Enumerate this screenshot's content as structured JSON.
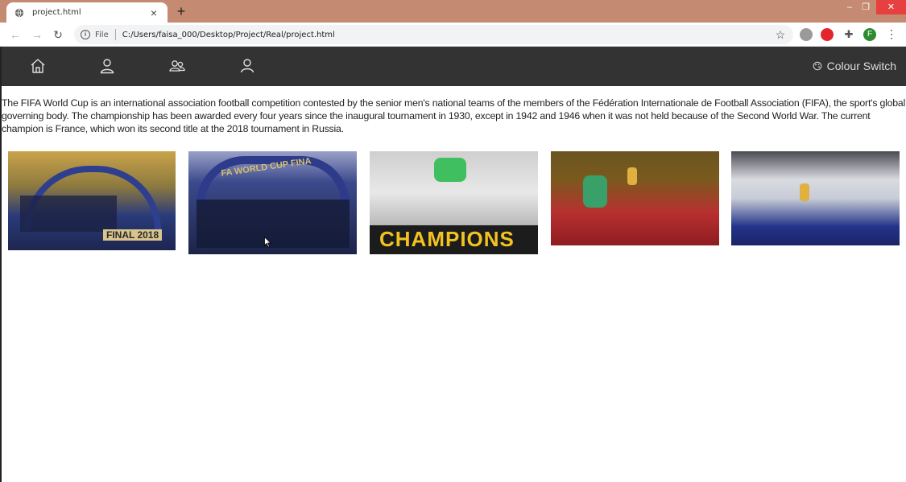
{
  "browser": {
    "tab_title": "project.html",
    "file_label": "File",
    "url": "C:/Users/faisa_000/Desktop/Project/Real/project.html",
    "profile_initial": "F"
  },
  "navbar": {
    "items": [
      {
        "icon": "home-icon"
      },
      {
        "icon": "user-icon"
      },
      {
        "icon": "users-icon"
      },
      {
        "icon": "profile-icon"
      }
    ],
    "colour_switch_label": "Colour Switch"
  },
  "content": {
    "intro": "The FIFA World Cup is an international association football competition contested by the senior men's national teams of the members of the Fédération Internationale de Football Association (FIFA), the sport's global governing body. The championship has been awarded every four years since the inaugural tournament in 1930, except in 1942 and 1946 when it was not held because of the Second World War. The current champion is France, which won its second title at the 2018 tournament in Russia.",
    "images": [
      {
        "name": "france-2018-final-photo",
        "banner": "FINAL 2018",
        "colors": [
          "#c9a34a",
          "#2a3b7a"
        ]
      },
      {
        "name": "world-cup-final-celebration-photo",
        "banner": "FA WORLD CUP FINA",
        "colors": [
          "#3b4a8c",
          "#1c2448"
        ]
      },
      {
        "name": "germany-champions-photo",
        "banner": "CHAMPIONS",
        "colors": [
          "#e8e8e8",
          "#f2c320"
        ]
      },
      {
        "name": "red-team-trophy-photo",
        "banner": "",
        "colors": [
          "#7a5a1e",
          "#c8282a"
        ]
      },
      {
        "name": "confetti-celebration-photo",
        "banner": "",
        "colors": [
          "#d9dbe0",
          "#24338a"
        ]
      }
    ]
  },
  "colors": {
    "titlebar": "#c48a72",
    "navbar": "#333333",
    "close_button": "#e64040"
  }
}
